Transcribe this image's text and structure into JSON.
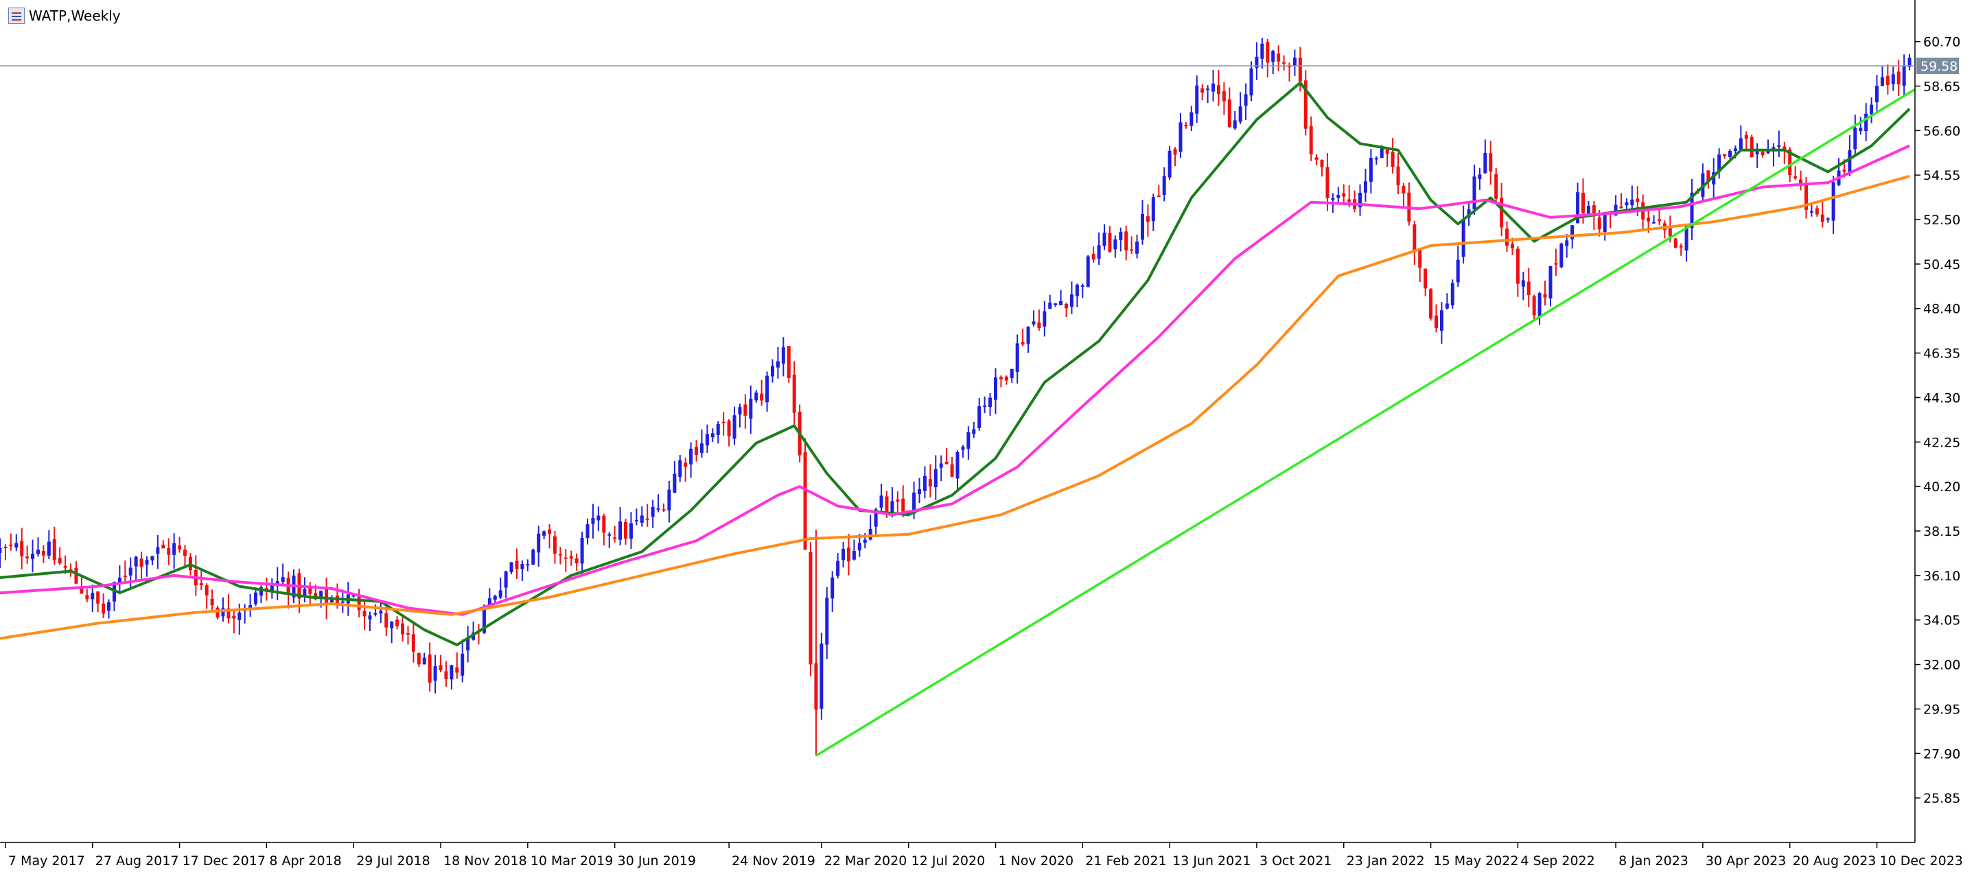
{
  "window": {
    "title": "WATP,Weekly",
    "icon": "chart-window-icon"
  },
  "colors": {
    "bull": "#1f1fe0",
    "bear": "#ee1111",
    "ma_fast": "#1c7d1c",
    "ma_mid": "#ff33dd",
    "ma_slow": "#ff8c1a",
    "trendline": "#33ee22",
    "price_line": "#8899aa",
    "axis": "#000000"
  },
  "chart_data": {
    "type": "candlestick",
    "title": "WATP,Weekly",
    "y_ticks": [
      60.7,
      58.65,
      56.6,
      54.55,
      52.5,
      50.45,
      48.4,
      46.35,
      44.3,
      42.25,
      40.2,
      38.15,
      36.1,
      34.05,
      32.0,
      29.95,
      27.9,
      25.85
    ],
    "ylim": [
      23.8,
      62.3
    ],
    "x_ticks": [
      "7 May 2017",
      "27 Aug 2017",
      "17 Dec 2017",
      "8 Apr 2018",
      "29 Jul 2018",
      "18 Nov 2018",
      "10 Mar 2019",
      "30 Jun 2019",
      "24 Nov 2019",
      "22 Mar 2020",
      "12 Jul 2020",
      "1 Nov 2020",
      "21 Feb 2021",
      "13 Jun 2021",
      "3 Oct 2021",
      "23 Jan 2022",
      "15 May 2022",
      "4 Sep 2022",
      "8 Jan 2023",
      "30 Apr 2023",
      "20 Aug 2023",
      "10 Dec 2023"
    ],
    "xlim": [
      "2017-04-30",
      "2024-01-28"
    ],
    "current_price": 59.58,
    "close_anchors": [
      [
        "2017-04-30",
        37.2
      ],
      [
        "2017-06-25",
        37.4
      ],
      [
        "2017-07-30",
        36.1
      ],
      [
        "2017-09-10",
        34.4
      ],
      [
        "2017-10-15",
        36.8
      ],
      [
        "2017-12-10",
        37.4
      ],
      [
        "2017-12-31",
        36.5
      ],
      [
        "2018-01-21",
        35.2
      ],
      [
        "2018-02-11",
        34.3
      ],
      [
        "2018-03-25",
        35.1
      ],
      [
        "2018-04-29",
        35.9
      ],
      [
        "2018-06-10",
        34.9
      ],
      [
        "2018-07-15",
        35.1
      ],
      [
        "2018-08-19",
        34.6
      ],
      [
        "2018-09-30",
        33.2
      ],
      [
        "2018-11-04",
        31.6
      ],
      [
        "2018-11-25",
        31.0
      ],
      [
        "2018-12-30",
        33.6
      ],
      [
        "2019-02-10",
        36.3
      ],
      [
        "2019-03-31",
        37.8
      ],
      [
        "2019-05-05",
        36.6
      ],
      [
        "2019-06-02",
        38.4
      ],
      [
        "2019-07-14",
        38.1
      ],
      [
        "2019-08-25",
        39.1
      ],
      [
        "2019-09-22",
        41.3
      ],
      [
        "2019-10-20",
        42.4
      ],
      [
        "2019-11-24",
        42.9
      ],
      [
        "2020-01-05",
        44.5
      ],
      [
        "2020-02-02",
        46.8
      ],
      [
        "2020-02-23",
        42.0
      ],
      [
        "2020-03-08",
        31.5
      ],
      [
        "2020-03-15",
        29.5
      ],
      [
        "2020-03-29",
        35.4
      ],
      [
        "2020-04-19",
        36.8
      ],
      [
        "2020-05-17",
        38.2
      ],
      [
        "2020-06-07",
        39.3
      ],
      [
        "2020-07-05",
        39.0
      ],
      [
        "2020-08-09",
        40.5
      ],
      [
        "2020-09-06",
        41.2
      ],
      [
        "2020-10-11",
        43.9
      ],
      [
        "2020-11-08",
        45.1
      ],
      [
        "2020-12-13",
        47.6
      ],
      [
        "2021-01-17",
        48.6
      ],
      [
        "2021-02-14",
        49.3
      ],
      [
        "2021-03-14",
        51.4
      ],
      [
        "2021-04-25",
        51.4
      ],
      [
        "2021-05-30",
        53.6
      ],
      [
        "2021-06-27",
        56.8
      ],
      [
        "2021-07-18",
        58.4
      ],
      [
        "2021-08-08",
        59.3
      ],
      [
        "2021-08-29",
        56.5
      ],
      [
        "2021-09-19",
        58.2
      ],
      [
        "2021-10-10",
        60.7
      ],
      [
        "2021-10-31",
        59.3
      ],
      [
        "2021-11-21",
        60.3
      ],
      [
        "2021-12-12",
        55.6
      ],
      [
        "2022-01-09",
        53.5
      ],
      [
        "2022-02-06",
        53.3
      ],
      [
        "2022-03-06",
        55.6
      ],
      [
        "2022-04-03",
        54.5
      ],
      [
        "2022-05-01",
        50.4
      ],
      [
        "2022-05-22",
        47.4
      ],
      [
        "2022-06-12",
        49.6
      ],
      [
        "2022-07-03",
        53.2
      ],
      [
        "2022-07-24",
        55.8
      ],
      [
        "2022-08-14",
        52.2
      ],
      [
        "2022-09-04",
        49.9
      ],
      [
        "2022-09-25",
        47.9
      ],
      [
        "2022-10-23",
        50.7
      ],
      [
        "2022-11-20",
        53.3
      ],
      [
        "2022-12-18",
        52.4
      ],
      [
        "2023-01-29",
        53.3
      ],
      [
        "2023-02-26",
        52.4
      ],
      [
        "2023-03-26",
        50.9
      ],
      [
        "2023-04-23",
        54.2
      ],
      [
        "2023-05-21",
        55.3
      ],
      [
        "2023-06-18",
        56.1
      ],
      [
        "2023-07-16",
        55.1
      ],
      [
        "2023-08-13",
        55.5
      ],
      [
        "2023-09-10",
        53.4
      ],
      [
        "2023-10-01",
        52.2
      ],
      [
        "2023-10-22",
        54.5
      ],
      [
        "2023-11-12",
        56.4
      ],
      [
        "2023-12-03",
        57.4
      ],
      [
        "2023-12-17",
        59.2
      ],
      [
        "2024-01-07",
        58.9
      ],
      [
        "2024-01-21",
        59.6
      ]
    ],
    "series": [
      {
        "kind": "candles",
        "style": "bull-blue-bear-red"
      },
      {
        "kind": "moving-average",
        "color": "#1c7d1c",
        "points": [
          [
            "2017-04-30",
            36.0
          ],
          [
            "2017-07-30",
            36.3
          ],
          [
            "2017-10-01",
            35.3
          ],
          [
            "2017-12-31",
            36.6
          ],
          [
            "2018-03-04",
            35.6
          ],
          [
            "2018-06-03",
            35.1
          ],
          [
            "2018-09-02",
            34.9
          ],
          [
            "2018-10-28",
            33.6
          ],
          [
            "2018-12-09",
            32.9
          ],
          [
            "2019-02-10",
            34.3
          ],
          [
            "2019-05-05",
            36.1
          ],
          [
            "2019-08-04",
            37.2
          ],
          [
            "2019-10-06",
            39.1
          ],
          [
            "2019-12-29",
            42.2
          ],
          [
            "2020-02-16",
            43.0
          ],
          [
            "2020-03-29",
            40.8
          ],
          [
            "2020-05-10",
            39.1
          ],
          [
            "2020-07-12",
            38.9
          ],
          [
            "2020-09-06",
            39.8
          ],
          [
            "2020-11-01",
            41.5
          ],
          [
            "2021-01-03",
            45.0
          ],
          [
            "2021-03-14",
            46.9
          ],
          [
            "2021-05-16",
            49.7
          ],
          [
            "2021-07-11",
            53.5
          ],
          [
            "2021-08-29",
            55.6
          ],
          [
            "2021-10-03",
            57.1
          ],
          [
            "2021-11-28",
            58.8
          ],
          [
            "2022-01-02",
            57.2
          ],
          [
            "2022-02-13",
            56.0
          ],
          [
            "2022-04-03",
            55.7
          ],
          [
            "2022-05-15",
            53.4
          ],
          [
            "2022-06-19",
            52.3
          ],
          [
            "2022-07-31",
            53.5
          ],
          [
            "2022-09-25",
            51.5
          ],
          [
            "2022-11-20",
            52.6
          ],
          [
            "2023-02-05",
            53.0
          ],
          [
            "2023-04-09",
            53.3
          ],
          [
            "2023-06-18",
            55.7
          ],
          [
            "2023-08-13",
            55.7
          ],
          [
            "2023-10-08",
            54.7
          ],
          [
            "2023-12-03",
            55.9
          ],
          [
            "2024-01-21",
            57.6
          ]
        ]
      },
      {
        "kind": "moving-average",
        "color": "#ff33dd",
        "points": [
          [
            "2017-04-30",
            35.3
          ],
          [
            "2017-09-03",
            35.6
          ],
          [
            "2017-12-10",
            36.1
          ],
          [
            "2018-03-04",
            35.8
          ],
          [
            "2018-07-01",
            35.5
          ],
          [
            "2018-10-07",
            34.6
          ],
          [
            "2018-12-16",
            34.3
          ],
          [
            "2019-03-10",
            35.3
          ],
          [
            "2019-06-30",
            36.6
          ],
          [
            "2019-10-13",
            37.7
          ],
          [
            "2020-01-26",
            39.8
          ],
          [
            "2020-02-23",
            40.2
          ],
          [
            "2020-04-12",
            39.3
          ],
          [
            "2020-06-21",
            38.9
          ],
          [
            "2020-09-06",
            39.4
          ],
          [
            "2020-11-29",
            41.1
          ],
          [
            "2021-02-21",
            43.9
          ],
          [
            "2021-05-30",
            47.1
          ],
          [
            "2021-09-05",
            50.7
          ],
          [
            "2021-12-12",
            53.3
          ],
          [
            "2022-02-13",
            53.2
          ],
          [
            "2022-05-01",
            53.0
          ],
          [
            "2022-07-24",
            53.4
          ],
          [
            "2022-10-16",
            52.6
          ],
          [
            "2023-01-08",
            52.8
          ],
          [
            "2023-04-02",
            53.1
          ],
          [
            "2023-07-16",
            54.0
          ],
          [
            "2023-10-08",
            54.2
          ],
          [
            "2024-01-21",
            55.9
          ]
        ]
      },
      {
        "kind": "moving-average",
        "color": "#ff8c1a",
        "points": [
          [
            "2017-04-30",
            33.2
          ],
          [
            "2017-09-03",
            33.9
          ],
          [
            "2018-01-07",
            34.4
          ],
          [
            "2018-07-01",
            34.8
          ],
          [
            "2018-12-02",
            34.3
          ],
          [
            "2019-04-07",
            35.1
          ],
          [
            "2019-08-04",
            36.1
          ],
          [
            "2019-12-01",
            37.1
          ],
          [
            "2020-03-08",
            37.8
          ],
          [
            "2020-07-12",
            38.0
          ],
          [
            "2020-11-08",
            38.9
          ],
          [
            "2021-03-14",
            40.7
          ],
          [
            "2021-07-11",
            43.1
          ],
          [
            "2021-10-03",
            45.8
          ],
          [
            "2022-01-16",
            49.9
          ],
          [
            "2022-05-15",
            51.3
          ],
          [
            "2022-09-11",
            51.6
          ],
          [
            "2023-01-15",
            51.9
          ],
          [
            "2023-05-14",
            52.4
          ],
          [
            "2023-09-03",
            53.1
          ],
          [
            "2024-01-21",
            54.5
          ]
        ]
      },
      {
        "kind": "trendline",
        "color": "#33ee22",
        "from": [
          "2020-03-15",
          27.8
        ],
        "to": [
          "2024-01-28",
          58.5
        ]
      }
    ]
  }
}
